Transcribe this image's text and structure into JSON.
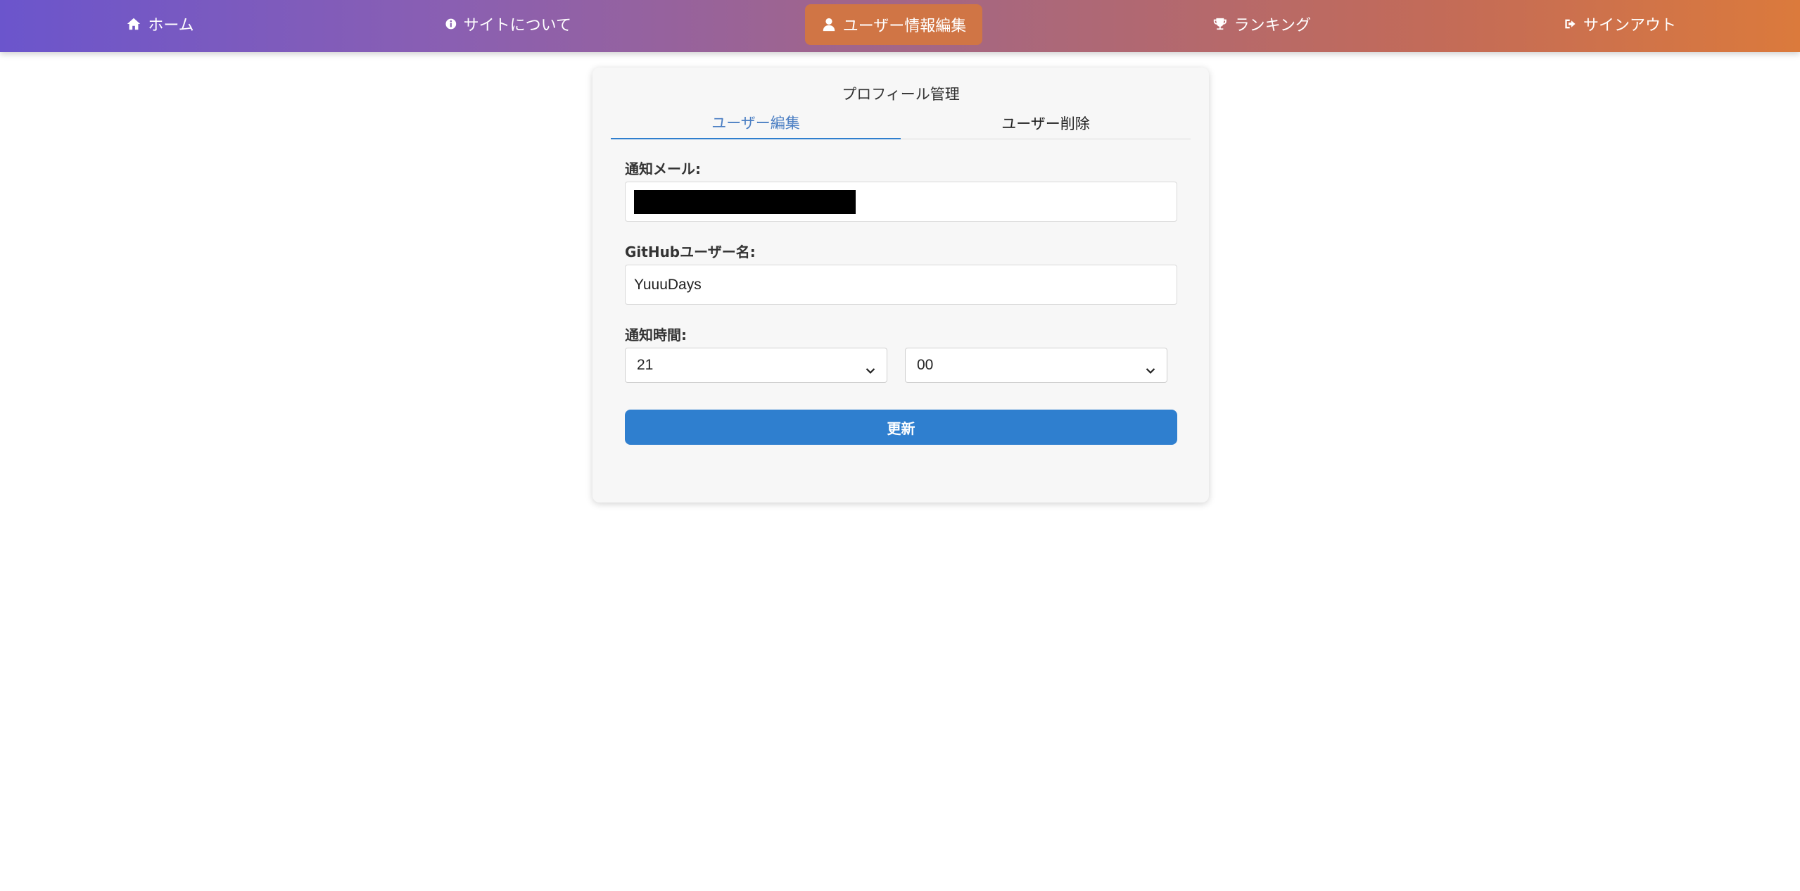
{
  "nav": {
    "home": {
      "label": "ホーム",
      "icon": "home-icon"
    },
    "about": {
      "label": "サイトについて",
      "icon": "info-icon"
    },
    "edit": {
      "label": "ユーザー情報編集",
      "icon": "user-icon",
      "active": true
    },
    "ranking": {
      "label": "ランキング",
      "icon": "trophy-icon"
    },
    "signout": {
      "label": "サインアウト",
      "icon": "sign-out-icon"
    }
  },
  "card": {
    "title": "プロフィール管理",
    "tabs": [
      {
        "label": "ユーザー編集",
        "active": true
      },
      {
        "label": "ユーザー削除",
        "active": false
      }
    ]
  },
  "form": {
    "email": {
      "label": "通知メール:",
      "value_redacted": true
    },
    "github": {
      "label": "GitHubユーザー名:",
      "value": "YuuuDays"
    },
    "time": {
      "label": "通知時間:",
      "hour": "21",
      "minute": "00"
    },
    "submit_label": "更新"
  },
  "colors": {
    "nav_gradient_start": "#6b55cc",
    "nav_gradient_end": "#db7a3c",
    "nav_active_bg": "#d07545",
    "accent_blue": "#2f7fcf",
    "card_bg": "#f7f7f7"
  }
}
